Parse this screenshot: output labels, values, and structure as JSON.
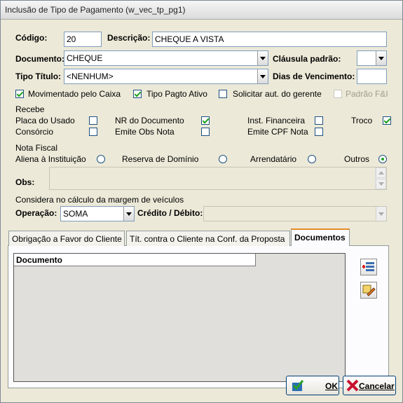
{
  "window": {
    "title": "Inclusão de Tipo de Pagamento (w_vec_tp_pg1)"
  },
  "form": {
    "codigo_label": "Código:",
    "codigo_value": "20",
    "descricao_label": "Descrição:",
    "descricao_value": "CHEQUE A VISTA",
    "documento_label": "Documento:",
    "documento_value": "CHEQUE",
    "clausula_label": "Cláusula padrão:",
    "clausula_value": "",
    "tipo_titulo_label": "Tipo Título:",
    "tipo_titulo_value": "<NENHUM>",
    "dias_venc_label": "Dias de Vencimento:",
    "dias_venc_value": ""
  },
  "flags": {
    "movimentado": {
      "label": "Movimentado pelo Caixa",
      "checked": true
    },
    "tipo_pagto": {
      "label": "Tipo Pagto Ativo",
      "checked": true
    },
    "solicitar": {
      "label": "Solicitar aut. do gerente",
      "checked": false
    },
    "padrao_fi": {
      "label": "Padrão F&I",
      "checked": false,
      "disabled": true
    }
  },
  "recebe": {
    "title": "Recebe",
    "placa_usado": {
      "label": "Placa do Usado",
      "checked": false
    },
    "consorcio": {
      "label": "Consórcio",
      "checked": false
    },
    "nr_documento": {
      "label": "NR do Documento",
      "checked": true
    },
    "emite_obs": {
      "label": "Emite Obs Nota",
      "checked": false
    },
    "inst_financeira": {
      "label": "Inst. Financeira",
      "checked": false
    },
    "emite_cpf": {
      "label": "Emite CPF Nota",
      "checked": false
    },
    "troco": {
      "label": "Troco",
      "checked": true
    }
  },
  "nota_fiscal": {
    "title": "Nota Fiscal",
    "options": [
      "Aliena à Instituição",
      "Reserva de Domínio",
      "Arrendatário",
      "Outros"
    ],
    "selected": "Outros",
    "obs_label": "Obs:",
    "obs_value": ""
  },
  "margem": {
    "title": "Considera no cálculo da margem de veículos",
    "operacao_label": "Operação:",
    "operacao_value": "SOMA",
    "credito_label": "Crédito / Débito:",
    "credito_value": ""
  },
  "tabs": [
    {
      "label": "Obrigação a Favor do Cliente",
      "active": false
    },
    {
      "label": "Tít. contra o Cliente na Conf. da Proposta",
      "active": false
    },
    {
      "label": "Documentos",
      "active": true
    }
  ],
  "grid": {
    "column": "Documento"
  },
  "buttons": {
    "ok": "OK",
    "cancel": "Cancelar"
  },
  "colors": {
    "check": "#21a121",
    "tab_accent": "#e68b2c",
    "cancel_x": "#c8102e"
  }
}
